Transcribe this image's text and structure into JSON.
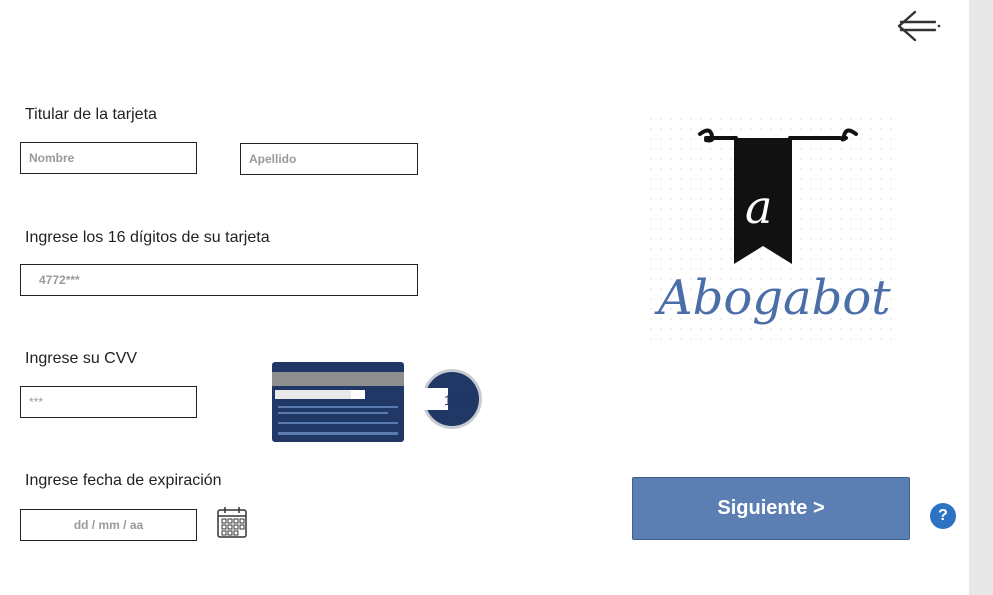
{
  "labels": {
    "holder": "Titular de la tarjeta",
    "digits": "Ingrese los 16 dígitos de su tarjeta",
    "cvv": "Ingrese su CVV",
    "expiry": "Ingrese fecha de expiración"
  },
  "inputs": {
    "first_name": "Nombre",
    "last_name": "Apellido",
    "card_number": "4772***",
    "cvv": "***",
    "expiry": "dd / mm / aa"
  },
  "card_example": {
    "cvv_digits": "123"
  },
  "logo": {
    "text": "Abogabot",
    "letter": "a"
  },
  "buttons": {
    "next": "Siguiente >",
    "help": "?"
  },
  "icons": {
    "back": "back-arrow-icon",
    "calendar": "calendar-icon",
    "help": "question-icon"
  },
  "colors": {
    "primary": "#5b7fb3",
    "help": "#2d73c4",
    "card": "#1f3866",
    "logo_text": "#4a6ea8"
  }
}
